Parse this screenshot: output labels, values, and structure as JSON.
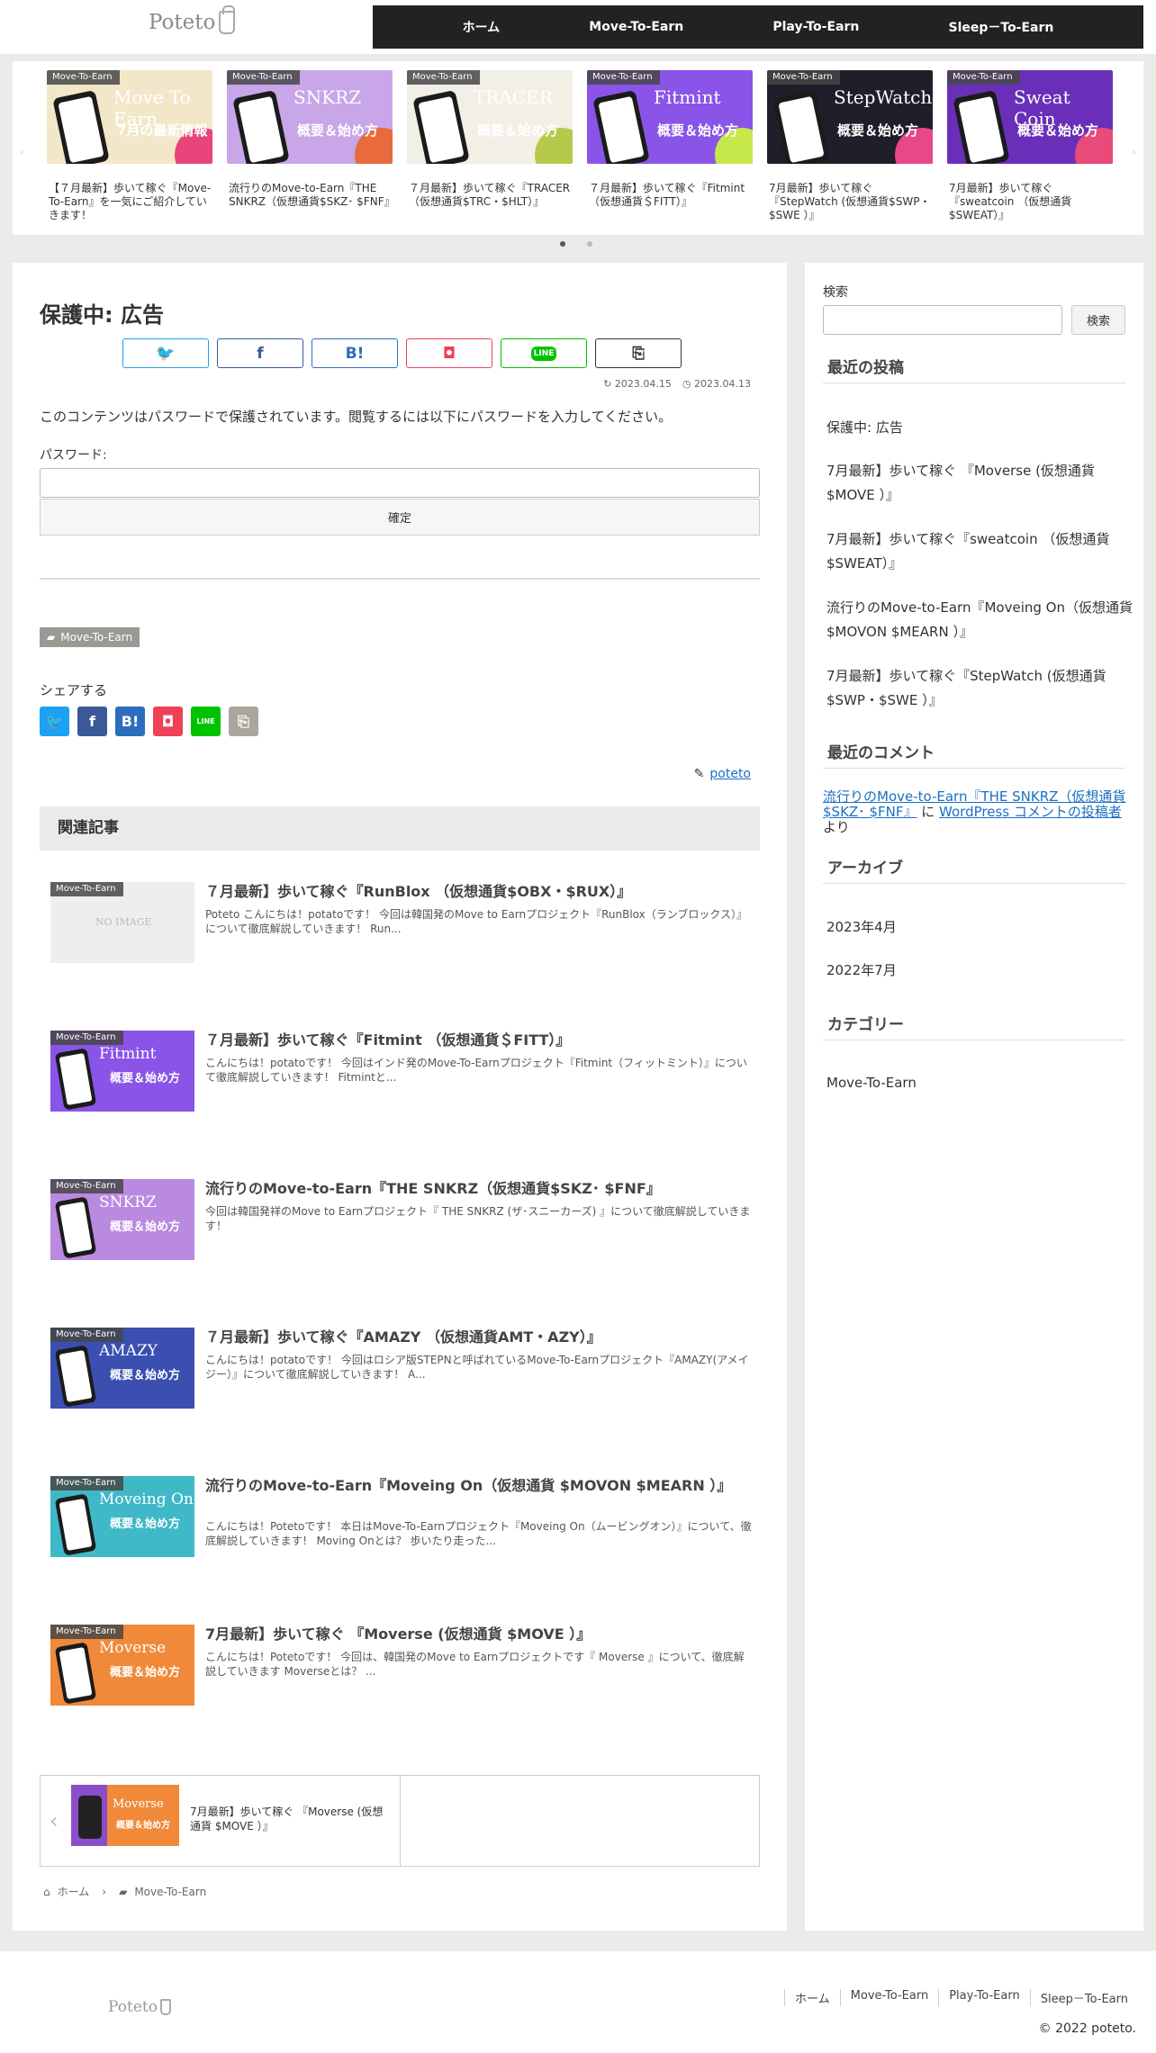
{
  "header": {
    "logo": "Poteto",
    "nav": [
      "ホーム",
      "Move-To-Earn",
      "Play-To-Earn",
      "Sleep－To-Earn"
    ]
  },
  "carousel": {
    "cards": [
      {
        "badge": "Move-To-Earn",
        "thumb_title": "Move To Earn",
        "thumb_sub": "7月の最新情報",
        "title": "【７月最新】歩いて稼ぐ『Move-To-Earn』を一気にご紹介していきます！",
        "bg": "#f2e7c8",
        "accent": "#e8457a"
      },
      {
        "badge": "Move-To-Earn",
        "thumb_title": "SNKRZ",
        "thumb_sub": "概要＆始め方",
        "title": "流行りのMove-to-Earn『THE SNKRZ（仮想通貨$SKZ･ $FNF』",
        "bg": "#c9a6e8",
        "accent": "#e86a3d"
      },
      {
        "badge": "Move-To-Earn",
        "thumb_title": "TRACER",
        "thumb_sub": "概要＆始め方",
        "title": "７月最新】歩いて稼ぐ『TRACER（仮想通貨$TRC・$HLT）』",
        "bg": "#f1efe6",
        "accent": "#b7c94a"
      },
      {
        "badge": "Move-To-Earn",
        "thumb_title": "Fitmint",
        "thumb_sub": "概要＆始め方",
        "title": "７月最新】歩いて稼ぐ『Fitmint （仮想通貨＄FITT）』",
        "bg": "#8a54e8",
        "accent": "#c6e84a"
      },
      {
        "badge": "Move-To-Earn",
        "thumb_title": "StepWatch",
        "thumb_sub": "概要＆始め方",
        "title": "7月最新】歩いて稼ぐ『StepWatch (仮想通貨$SWP・$SWE ）』",
        "bg": "#1f1f2a",
        "accent": "#e8478a"
      },
      {
        "badge": "Move-To-Earn",
        "thumb_title": "Sweat Coin",
        "thumb_sub": "概要＆始め方",
        "title": "7月最新】歩いて稼ぐ『sweatcoin （仮想通貨$SWEAT）』",
        "bg": "#6a2fb8",
        "accent": "#e84a7a"
      }
    ]
  },
  "post": {
    "title": "保護中: 広告",
    "share_buttons": [
      {
        "icon": "twitter-icon",
        "label": "🐦",
        "color": "#1da1f2"
      },
      {
        "icon": "facebook-icon",
        "label": "f",
        "color": "#3b5998"
      },
      {
        "icon": "hatena-icon",
        "label": "B!",
        "color": "#2c6ebd"
      },
      {
        "icon": "pocket-icon",
        "label": "◘",
        "color": "#ef4056"
      },
      {
        "icon": "line-icon",
        "label": "LINE",
        "color": "#00c300"
      },
      {
        "icon": "copy-icon",
        "label": "⎘",
        "color": "#333333"
      }
    ],
    "updated": "2023.04.15",
    "published": "2023.04.13",
    "protected_message": "このコンテンツはパスワードで保護されています。閲覧するには以下にパスワードを入力してください。",
    "password_label": "パスワード:",
    "password_value": "",
    "submit_label": "確定",
    "category": "Move-To-Earn",
    "share_label": "シェアする",
    "author": "poteto"
  },
  "related": {
    "heading": "関連記事",
    "items": [
      {
        "badge": "Move-To-Earn",
        "noimage": "NO IMAGE",
        "title": "７月最新】歩いて稼ぐ『RunBlox （仮想通貨$OBX・$RUX）』",
        "excerpt": "Poteto こんにちは！potatoです！ 今回は韓国発のMove to Earnプロジェクト『RunBlox（ランブロックス）』について徹底解説していきます！ Run...",
        "bg": "#eeeeee"
      },
      {
        "badge": "Move-To-Earn",
        "thumb_title": "Fitmint",
        "thumb_sub": "概要＆始め方",
        "title": "７月最新】歩いて稼ぐ『Fitmint （仮想通貨＄FITT）』",
        "excerpt": "こんにちは！potatoです！ 今回はインド発のMove-To-Earnプロジェクト『Fitmint（フィットミント）』について徹底解説していきます！ Fitmintと...",
        "bg": "#8a54e8"
      },
      {
        "badge": "Move-To-Earn",
        "thumb_title": "SNKRZ",
        "thumb_sub": "概要＆始め方",
        "title": "流行りのMove-to-Earn『THE SNKRZ（仮想通貨$SKZ･ $FNF』",
        "excerpt": "今回は韓国発祥のMove to Earnプロジェクト『 THE SNKRZ (ザ･スニーカーズ) 』について徹底解説していきます！",
        "bg": "#b98ae0"
      },
      {
        "badge": "Move-To-Earn",
        "thumb_title": "AMAZY",
        "thumb_sub": "概要＆始め方",
        "title": "７月最新】歩いて稼ぐ『AMAZY （仮想通貨AMT・AZY）』",
        "excerpt": "こんにちは！potatoです！ 今回はロシア版STEPNと呼ばれているMove-To-Earnプロジェクト『AMAZY(アメイジー）』について徹底解説していきます！ A...",
        "bg": "#3a4fb0"
      },
      {
        "badge": "Move-To-Earn",
        "thumb_title": "Moveing On",
        "thumb_sub": "概要＆始め方",
        "title": "流行りのMove-to-Earn『Moveing On（仮想通貨 $MOVON $MEARN ）』",
        "excerpt": "こんにちは！Potetoです！ 本日はMove-To-Earnプロジェクト『Moveing On（ムービングオン）』について、徹底解説していきます！ Moving Onとは？ 歩いたり走った...",
        "bg": "#3fb8c8"
      },
      {
        "badge": "Move-To-Earn",
        "thumb_title": "Moverse",
        "thumb_sub": "概要＆始め方",
        "title": "7月最新】歩いて稼ぐ 『Moverse (仮想通貨 $MOVE ）』",
        "excerpt": "こんにちは！Potetoです！ 今回は、韓国発のMove to Earnプロジェクトです『 Moverse 』について、徹底解説していきます Moverseとは？ ...",
        "bg": "#f08a3a"
      }
    ]
  },
  "pager": {
    "prev_title": "7月最新】歩いて稼ぐ 『Moverse (仮想通貨 $MOVE ）』",
    "prev_thumb_title": "Moverse",
    "prev_thumb_sub": "概要＆始め方"
  },
  "breadcrumb": [
    "ホーム",
    "Move-To-Earn"
  ],
  "sidebar": {
    "search_label": "検索",
    "search_button": "検索",
    "search_value": "",
    "recent_heading": "最近の投稿",
    "recent_posts": [
      "保護中: 広告",
      "7月最新】歩いて稼ぐ 『Moverse (仮想通貨 $MOVE ）』",
      "7月最新】歩いて稼ぐ『sweatcoin （仮想通貨$SWEAT）』",
      "流行りのMove-to-Earn『Moveing On（仮想通貨 $MOVON $MEARN ）』",
      "7月最新】歩いて稼ぐ『StepWatch (仮想通貨$SWP・$SWE ）』"
    ],
    "comments_heading": "最近のコメント",
    "comment_post": "流行りのMove-to-Earn『THE SNKRZ（仮想通貨$SKZ･ $FNF』",
    "comment_mid": "に",
    "comment_author": "WordPress コメントの投稿者",
    "comment_end": "より",
    "archive_heading": "アーカイブ",
    "archives": [
      "2023年4月",
      "2022年7月"
    ],
    "category_heading": "カテゴリー",
    "categories": [
      "Move-To-Earn"
    ]
  },
  "footer": {
    "logo": "Poteto",
    "nav": [
      "ホーム",
      "Move-To-Earn",
      "Play-To-Earn",
      "Sleep－To-Earn"
    ],
    "copyright": "© 2022 poteto."
  }
}
